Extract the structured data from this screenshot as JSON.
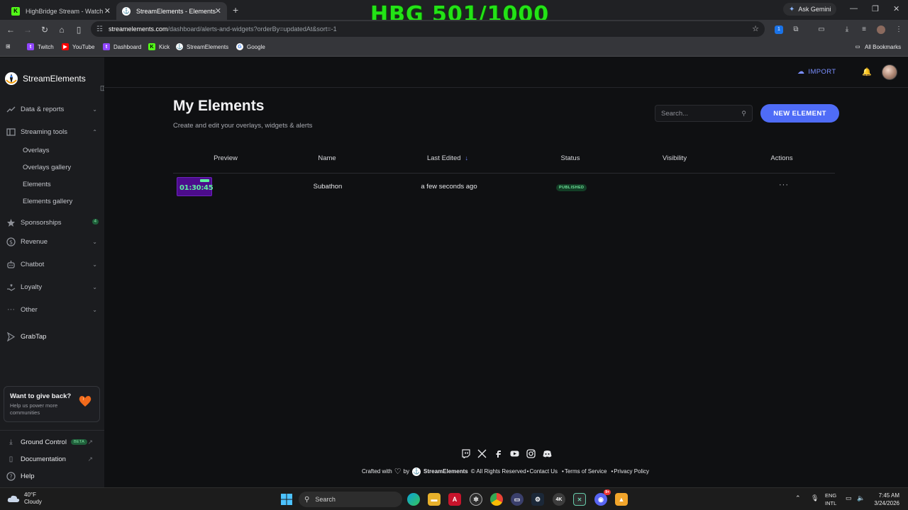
{
  "browser": {
    "tabs": [
      {
        "title": "HighBridge Stream - Watch Live"
      },
      {
        "title": "StreamElements - Elements"
      }
    ],
    "overlay_text": "HBG 501/1000",
    "ask_gemini": "Ask Gemini",
    "url_host": "streamelements.com",
    "url_path": "/dashboard/alerts-and-widgets?orderBy=updatedAt&sort=-1",
    "bookmarks": [
      "Twitch",
      "YouTube",
      "Dashboard",
      "Kick",
      "StreamElements",
      "Google"
    ],
    "all_bookmarks": "All Bookmarks",
    "extension_badge": "1"
  },
  "sidebar": {
    "brand": "StreamElements",
    "nav": {
      "data_reports": "Data & reports",
      "streaming_tools": "Streaming tools",
      "overlays": "Overlays",
      "overlays_gallery": "Overlays gallery",
      "elements": "Elements",
      "elements_gallery": "Elements gallery",
      "sponsorships": "Sponsorships",
      "sponsorships_count": "4",
      "revenue": "Revenue",
      "chatbot": "Chatbot",
      "loyalty": "Loyalty",
      "other": "Other",
      "grabtap": "GrabTap"
    },
    "promo": {
      "title": "Want to give back?",
      "subtitle": "Help us power more communities"
    },
    "bottom": {
      "ground_control": "Ground Control",
      "beta": "BETA",
      "documentation": "Documentation",
      "help": "Help"
    }
  },
  "header": {
    "import": "IMPORT"
  },
  "main": {
    "title": "My Elements",
    "subtitle": "Create and edit your overlays, widgets & alerts",
    "search_placeholder": "Search...",
    "new_element": "NEW ELEMENT",
    "columns": [
      "Preview",
      "Name",
      "Last Edited",
      "Status",
      "Visibility",
      "Actions"
    ],
    "rows": [
      {
        "thumb_time": "01:30:45",
        "name": "Subathon",
        "last_edited": "a few seconds ago",
        "status": "PUBLISHED",
        "visibility": "",
        "actions": "···"
      }
    ]
  },
  "footer": {
    "crafted_with": "Crafted with",
    "by": "by",
    "brand": "StreamElements",
    "rights": "© All Rights Reserved",
    "contact": "Contact Us",
    "terms": "Terms of Service",
    "privacy": "Privacy Policy"
  },
  "taskbar": {
    "temp": "40°F",
    "weather": "Cloudy",
    "search": "Search",
    "lang1": "ENG",
    "lang2": "INTL",
    "time": "7:45 AM",
    "date": "3/24/2026",
    "discord_badge": "9+"
  },
  "colors": {
    "accent": "#4f6cf7",
    "published": "#6ee39b",
    "overlay_green": "#23e316"
  }
}
